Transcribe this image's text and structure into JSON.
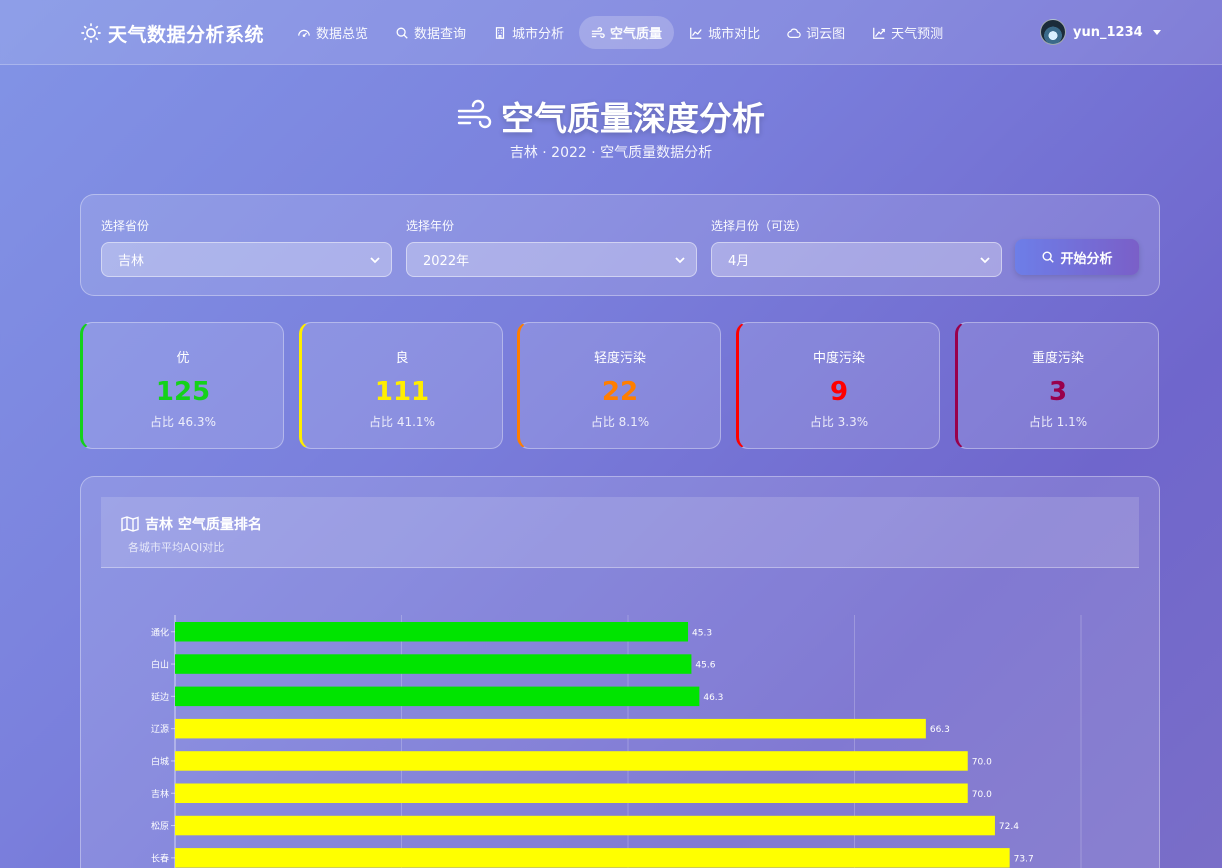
{
  "app": {
    "title": "天气数据分析系统"
  },
  "nav": [
    {
      "label": "数据总览",
      "icon": "dashboard-icon",
      "active": false
    },
    {
      "label": "数据查询",
      "icon": "search-icon",
      "active": false
    },
    {
      "label": "城市分析",
      "icon": "building-icon",
      "active": false
    },
    {
      "label": "空气质量",
      "icon": "wind-icon",
      "active": true
    },
    {
      "label": "城市对比",
      "icon": "line-chart-icon",
      "active": false
    },
    {
      "label": "词云图",
      "icon": "cloud-icon",
      "active": false
    },
    {
      "label": "天气预测",
      "icon": "trend-chart-icon",
      "active": false
    }
  ],
  "user": {
    "name": "yun_1234"
  },
  "header": {
    "title": "空气质量深度分析",
    "subtitle": "吉林 · 2022 · 空气质量数据分析"
  },
  "filters": {
    "province_label": "选择省份",
    "province_value": "吉林",
    "year_label": "选择年份",
    "year_value": "2022年",
    "month_label": "选择月份（可选）",
    "month_value": "4月",
    "submit_label": "开始分析"
  },
  "stats": [
    {
      "label": "优",
      "value": "125",
      "pct": "占比 46.3%",
      "color": "#14d21a"
    },
    {
      "label": "良",
      "value": "111",
      "pct": "占比 41.1%",
      "color": "#ffee00"
    },
    {
      "label": "轻度污染",
      "value": "22",
      "pct": "占比 8.1%",
      "color": "#ff7e00"
    },
    {
      "label": "中度污染",
      "value": "9",
      "pct": "占比 3.3%",
      "color": "#ff0000"
    },
    {
      "label": "重度污染",
      "value": "3",
      "pct": "占比 1.1%",
      "color": "#99004c"
    }
  ],
  "ranking": {
    "title": "吉林 空气质量排名",
    "subtitle": "各城市平均AQI对比"
  },
  "chart_data": {
    "type": "bar",
    "orientation": "horizontal",
    "categories": [
      "通化",
      "白山",
      "延边",
      "辽源",
      "白城",
      "吉林",
      "松原",
      "长春"
    ],
    "values": [
      45.3,
      45.6,
      46.3,
      66.3,
      70.0,
      70.0,
      72.4,
      73.7
    ],
    "value_labels": [
      "45.3",
      "45.6",
      "46.3",
      "66.3",
      "70.0",
      "70.0",
      "72.4",
      "73.7"
    ],
    "colors": [
      "#00e400",
      "#00e400",
      "#00e400",
      "#ffff00",
      "#ffff00",
      "#ffff00",
      "#ffff00",
      "#ffff00"
    ],
    "xlim": [
      0,
      80
    ],
    "grid": true
  }
}
